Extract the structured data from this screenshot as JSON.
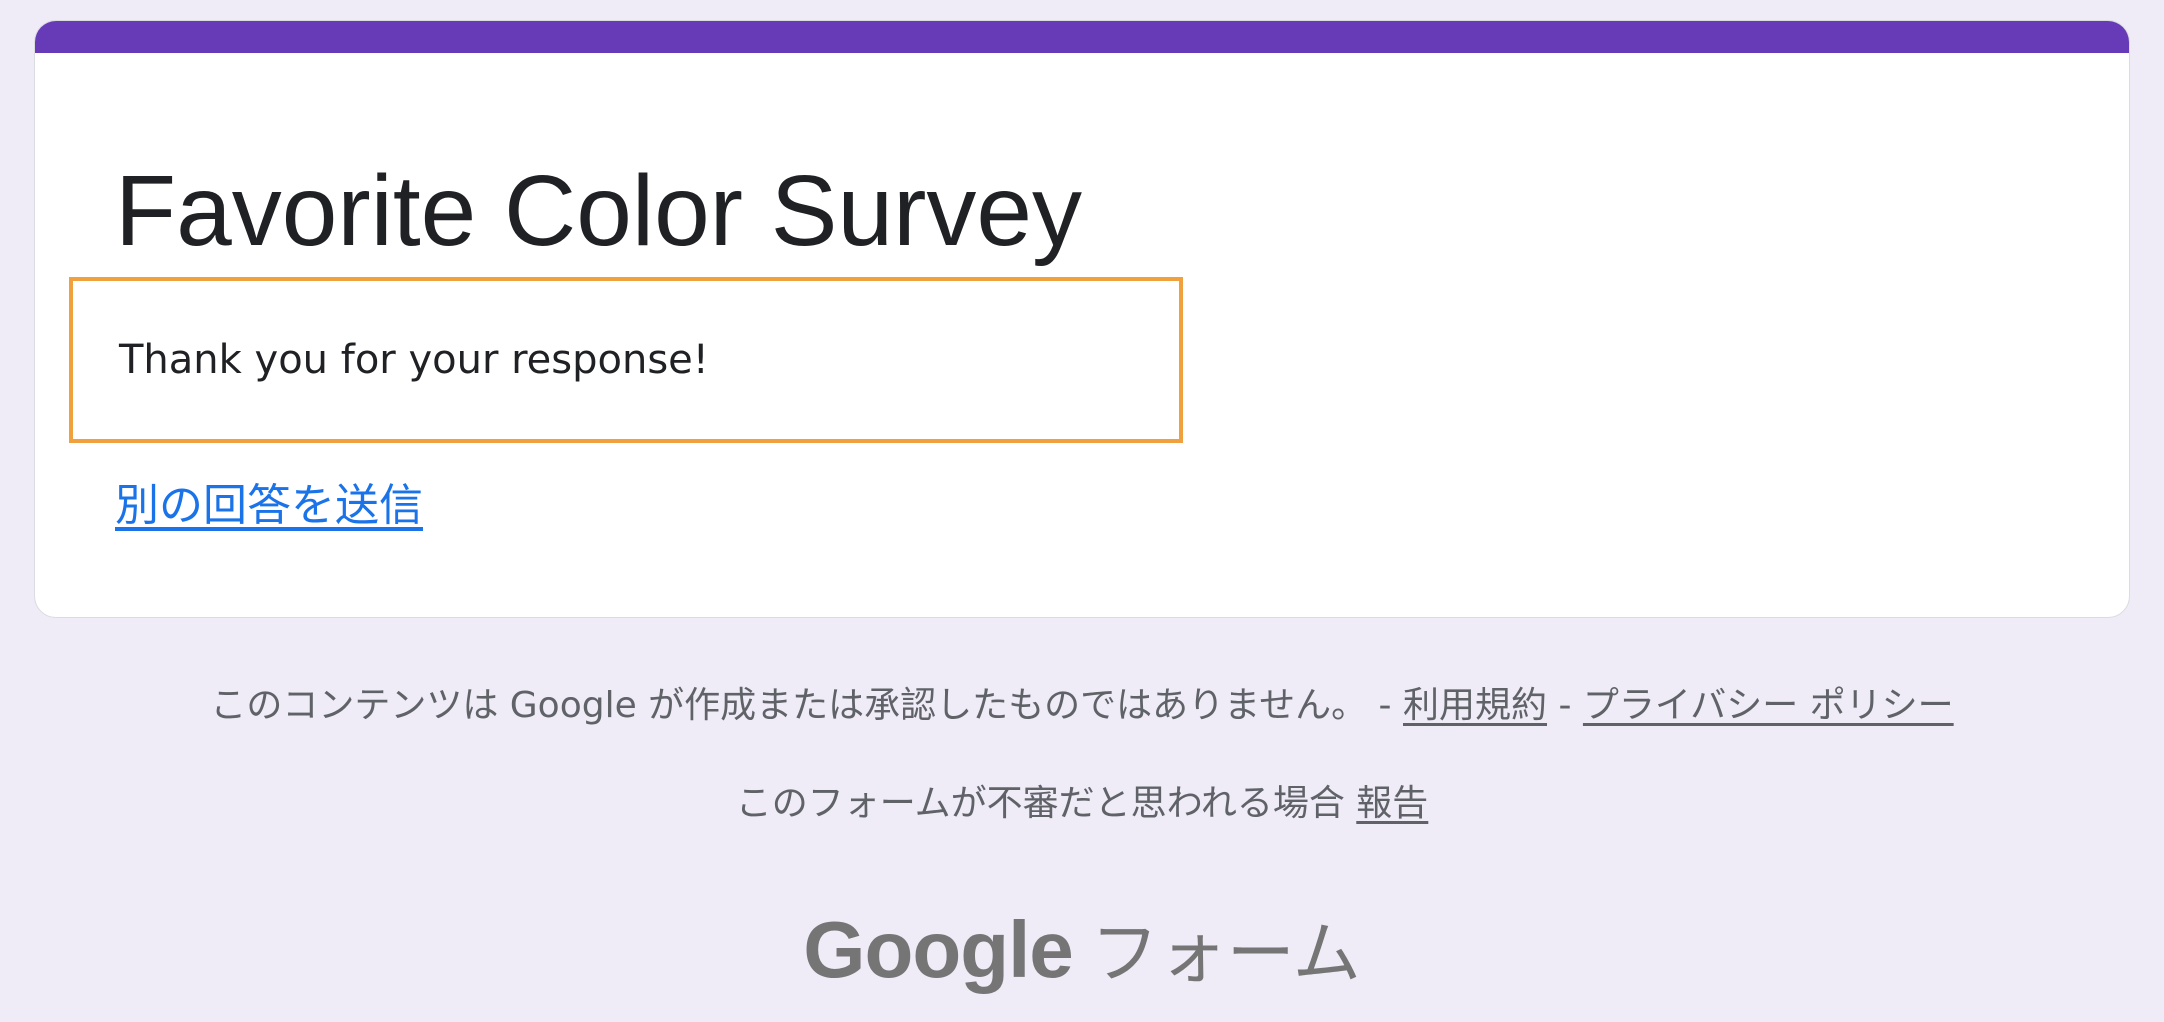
{
  "theme": {
    "accent_color": "#673ab7",
    "background_color": "#efebf7",
    "highlight_border_color": "#f0a03c",
    "link_color": "#1a73e8"
  },
  "form": {
    "title": "Favorite Color Survey",
    "confirmation_message": "Thank you for your response!",
    "submit_another_link": "別の回答を送信"
  },
  "footer": {
    "disclaimer_text": "このコンテンツは Google が作成または承認したものではありません。 -",
    "separator": "-",
    "terms_link": "利用規約",
    "privacy_link": "プライバシー ポリシー",
    "report_prompt": "このフォームが不審だと思われる場合",
    "report_link": "報告",
    "brand_google": "Google",
    "brand_product": "フォーム"
  }
}
